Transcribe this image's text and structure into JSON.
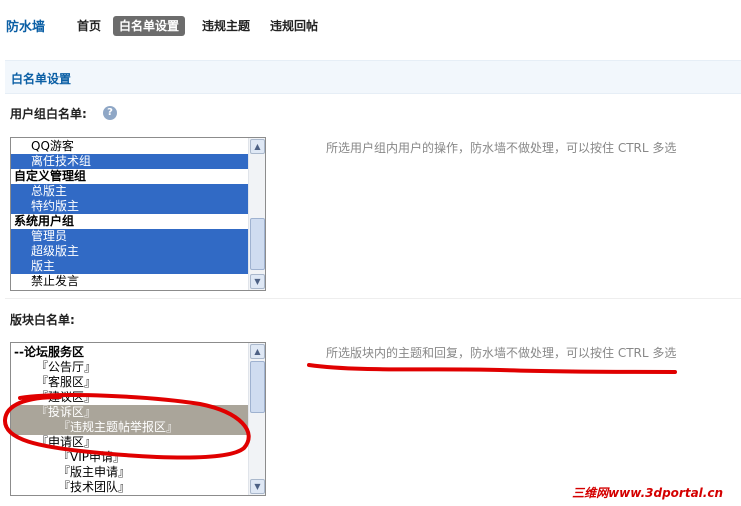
{
  "nav": {
    "brand": "防水墙",
    "items": [
      "首页",
      "白名单设置",
      "违规主题",
      "违规回帖"
    ]
  },
  "section": {
    "title": "白名单设置"
  },
  "usergroup": {
    "label": "用户组白名单:",
    "help_icon": "?",
    "hint": "所选用户组内用户的操作，防水墙不做处理，可以按住 CTRL 多选",
    "options": [
      {
        "text": "QQ游客",
        "group": false,
        "selected": false
      },
      {
        "text": "离任技术组",
        "group": false,
        "selected": true
      },
      {
        "text": "自定义管理组",
        "group": true,
        "selected": false
      },
      {
        "text": "总版主",
        "group": false,
        "selected": true
      },
      {
        "text": "特约版主",
        "group": false,
        "selected": true
      },
      {
        "text": "系统用户组",
        "group": true,
        "selected": false
      },
      {
        "text": "管理员",
        "group": false,
        "selected": true
      },
      {
        "text": "超级版主",
        "group": false,
        "selected": true
      },
      {
        "text": "版主",
        "group": false,
        "selected": true
      },
      {
        "text": "禁止发言",
        "group": false,
        "selected": false
      }
    ]
  },
  "forum": {
    "label": "版块白名单:",
    "hint": "所选版块内的主题和回复，防水墙不做处理，可以按住 CTRL 多选",
    "options": [
      {
        "text": "--论坛服务区",
        "level": 0,
        "bold": true,
        "selected": false
      },
      {
        "text": "『公告厅』",
        "level": 1,
        "bold": false,
        "selected": false
      },
      {
        "text": "『客服区』",
        "level": 1,
        "bold": false,
        "selected": false
      },
      {
        "text": "『建议区』",
        "level": 1,
        "bold": false,
        "selected": false
      },
      {
        "text": "『投诉区』",
        "level": 1,
        "bold": false,
        "selected": true
      },
      {
        "text": "『违规主题帖举报区』",
        "level": 2,
        "bold": false,
        "selected": true
      },
      {
        "text": "『申请区』",
        "level": 1,
        "bold": false,
        "selected": false
      },
      {
        "text": "『VIP申请』",
        "level": 2,
        "bold": false,
        "selected": false
      },
      {
        "text": "『版主申请』",
        "level": 2,
        "bold": false,
        "selected": false
      },
      {
        "text": "『技术团队』",
        "level": 2,
        "bold": false,
        "selected": false
      }
    ]
  },
  "watermark": "三维网www.3dportal.cn",
  "colors": {
    "brand": "#0b5fa5",
    "selection": "#316ac5",
    "annotation": "#e00000"
  }
}
